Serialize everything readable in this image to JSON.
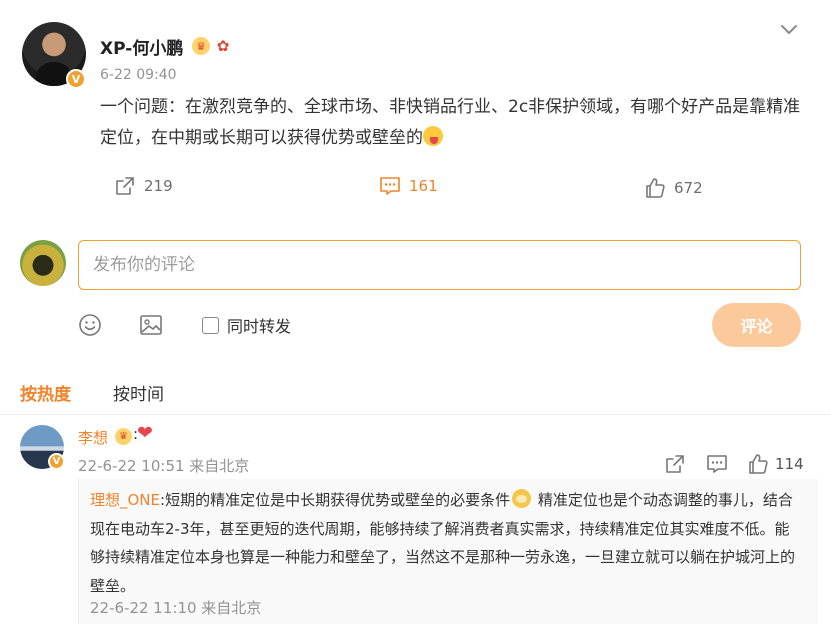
{
  "post": {
    "username": "XP-何小鹏",
    "verified_mark": "V",
    "time": "6-22 09:40",
    "text": "一个问题：在激烈竞争的、全球市场、非快销品行业、2c非保护领域，有哪个好产品是靠精准定位，在中期或长期可以获得优势或壁垒的",
    "shares": "219",
    "comments": "161",
    "likes": "672"
  },
  "composer": {
    "placeholder": "发布你的评论",
    "repost_label": "同时转发",
    "submit_label": "评论"
  },
  "sort": {
    "hot_label": "按热度",
    "time_label": "按时间"
  },
  "comment": {
    "username": "李想",
    "colon": ":",
    "heart": "❤",
    "verified_mark": "V",
    "meta": "22-6-22 10:51 来自北京",
    "likes": "114",
    "reply": {
      "username": "理想_ONE",
      "text_before": ":短期的精准定位是中长期获得优势或壁垒的必要条件",
      "text_after": " 精准定位也是个动态调整的事儿，结合现在电动车2-3年，甚至更短的迭代周期，能够持续了解消费者真实需求，持续精准定位其实难度不低。能够持续精准定位本身也算是一种能力和壁垒了，当然这不是那种一劳永逸，一旦建立就可以躺在护城河上的壁垒。",
      "meta": "22-6-22 11:10 来自北京"
    }
  },
  "colors": {
    "accent": "#f0832c",
    "input_border": "#f0a22e",
    "submit_bg": "#fcc99d",
    "muted_text": "#939393"
  },
  "icons": [
    "chevron-down-icon",
    "share-icon",
    "comment-icon",
    "like-icon",
    "emoji-icon",
    "image-icon",
    "heart-icon"
  ]
}
